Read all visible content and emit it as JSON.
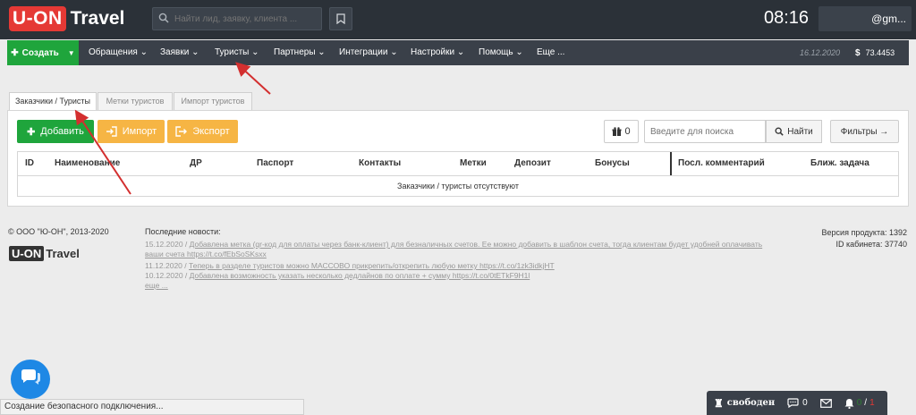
{
  "header": {
    "logo_box": "U-ON",
    "logo_text": "Travel",
    "search_placeholder": "Найти лид, заявку, клиента ...",
    "clock": "08:16",
    "user_email": "@gm..."
  },
  "nav": {
    "create_label": "Создать",
    "items": [
      "Обращения",
      "Заявки",
      "Туристы",
      "Партнеры",
      "Интеграции",
      "Настройки",
      "Помощь",
      "Еще ..."
    ],
    "date": "16.12.2020",
    "currency_symbol": "$",
    "rate": "73.4453"
  },
  "tabs": [
    "Заказчики / Туристы",
    "Метки туристов",
    "Импорт туристов"
  ],
  "toolbar": {
    "add_label": "Добавить",
    "import_label": "Импорт",
    "export_label": "Экспорт",
    "gift_count": "0",
    "search_placeholder": "Введите для поиска",
    "find_label": "Найти",
    "filters_label": "Фильтры →"
  },
  "table": {
    "columns": [
      "ID",
      "Наименование",
      "ДР",
      "Паспорт",
      "Контакты",
      "Метки",
      "Депозит",
      "Бонусы",
      "Посл. комментарий",
      "Ближ. задача"
    ],
    "empty_message": "Заказчики / туристы отсутствуют"
  },
  "footer": {
    "copyright": "© ООО \"Ю-ОН\", 2013-2020",
    "logo_box": "U-ON",
    "logo_text": "Travel",
    "news_title": "Последние новости:",
    "news": [
      {
        "date": "15.12.2020 /",
        "text": "Добавлена метка (qr-код для оплаты через банк-клиент) для безналичных счетов. Ее можно добавить в шаблон счета, тогда клиентам будет удобней оплачивать ваши счета https://t.co/fEbSoSKsxx"
      },
      {
        "date": "11.12.2020 /",
        "text": "Теперь в разделе туристов можно МАССОВО прикрепить/открепить любую метку https://t.co/1zk3idkjHT"
      },
      {
        "date": "10.12.2020 /",
        "text": "Добавлена возможность указать несколько дедлайнов по оплате + сумму https://t.co/0tETkF9H1l"
      }
    ],
    "news_more": "еще ...",
    "version_label": "Версия продукта: 1392",
    "cabinet_label": "ID кабинета: 37740"
  },
  "status_bar": {
    "text": "Создание безопасного подключения..."
  },
  "bottom_bar": {
    "free_label": "свободен",
    "chat_count": "0",
    "bell_green": "0",
    "bell_separator": "/",
    "bell_red": "1"
  },
  "colors": {
    "header_bg": "#2b3138",
    "nav_bg": "#3a4049",
    "green": "#1fa53c",
    "orange": "#f6b544",
    "logo_red": "#e53935",
    "chat_blue": "#1e88e5",
    "arrow_red": "#d32f2f"
  }
}
